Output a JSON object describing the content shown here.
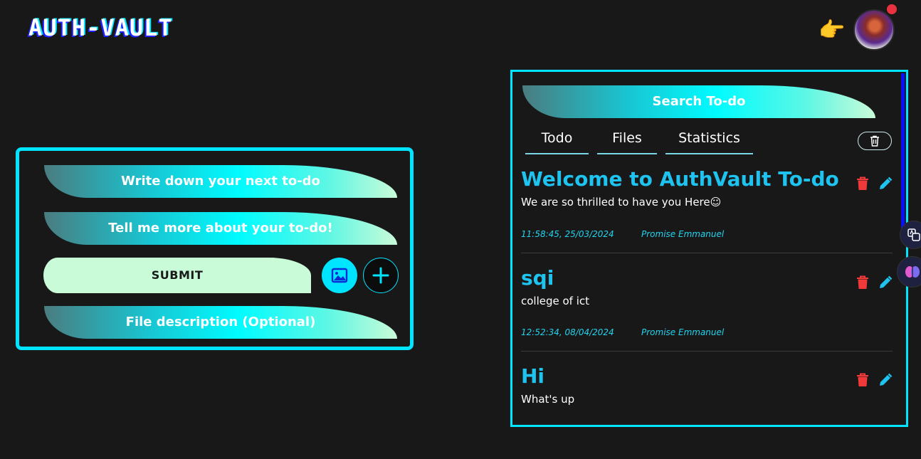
{
  "header": {
    "logo_text": "AUTH-VAULT",
    "pointer_emoji": "👉"
  },
  "form": {
    "title_placeholder": "Write down your next to-do",
    "details_placeholder": "Tell me more about your to-do!",
    "submit_label": "SUBMIT",
    "file_description_placeholder": "File description (Optional)"
  },
  "panel": {
    "search_placeholder": "Search To-do",
    "tabs": [
      {
        "label": "Todo"
      },
      {
        "label": "Files"
      },
      {
        "label": "Statistics"
      }
    ],
    "todos": [
      {
        "title": "Welcome to AuthVault To-do",
        "description": "We are so thrilled to have you Here☺",
        "timestamp": "11:58:45, 25/03/2024",
        "author": "Promise Emmanuel"
      },
      {
        "title": "sqi",
        "description": "college of ict",
        "timestamp": "12:52:34, 08/04/2024",
        "author": "Promise Emmanuel"
      },
      {
        "title": "Hi",
        "description": "What's up",
        "timestamp": "",
        "author": ""
      }
    ]
  },
  "colors": {
    "accent": "#00e5ff",
    "title_blue": "#1ec3ef",
    "delete_red": "#f03a3a",
    "background": "#181818",
    "submit_bg": "#c9fbd8"
  },
  "icons": [
    "image-icon",
    "plus-icon",
    "trash-icon",
    "delete-icon",
    "edit-icon",
    "translate-icon",
    "brain-icon"
  ]
}
